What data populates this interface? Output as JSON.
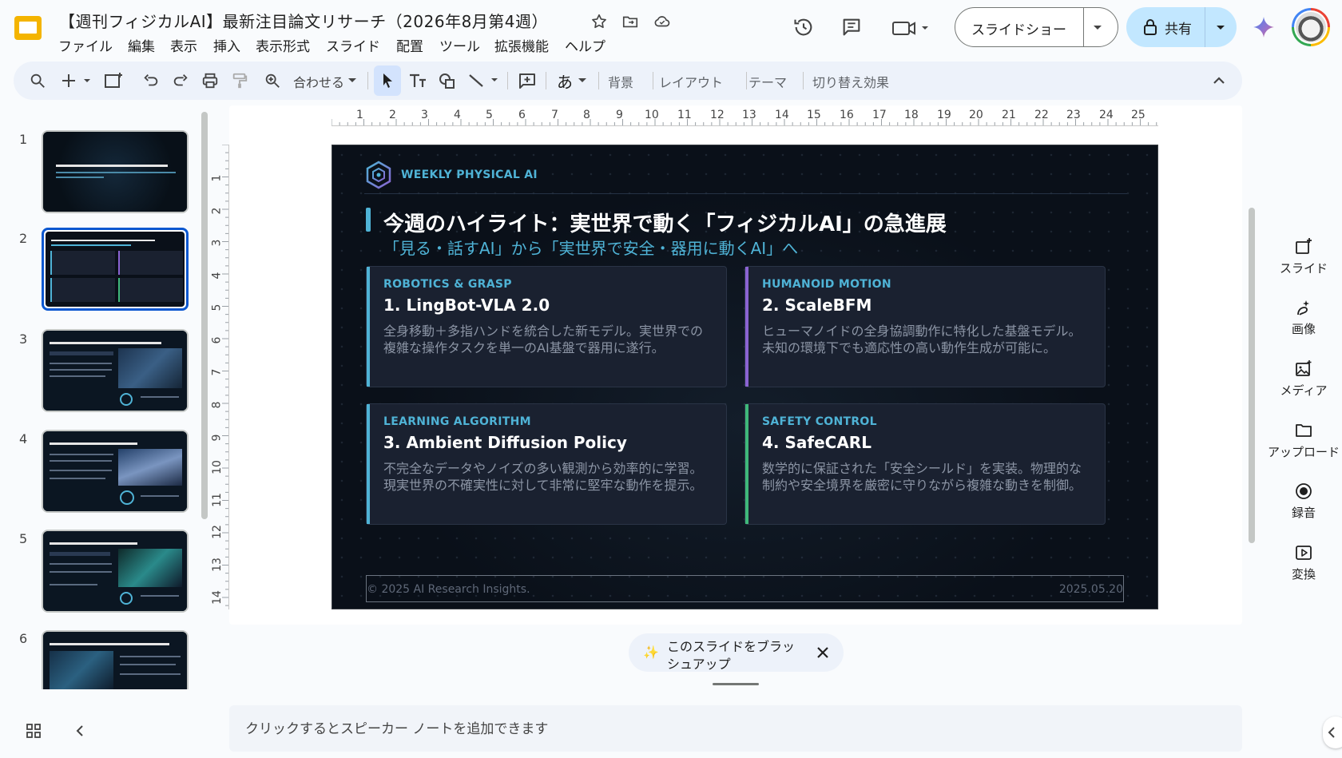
{
  "header": {
    "title": "【週刊フィジカルAI】最新注目論文リサーチ（2026年8月第4週）",
    "menu": [
      "ファイル",
      "編集",
      "表示",
      "挿入",
      "表示形式",
      "スライド",
      "配置",
      "ツール",
      "拡張機能",
      "ヘルプ"
    ],
    "slideshow_label": "スライドショー",
    "share_label": "共有"
  },
  "toolbar": {
    "zoom_label": "合わせる",
    "background": "背景",
    "layout": "レイアウト",
    "theme": "テーマ",
    "transition": "切り替え効果"
  },
  "ruler": {
    "h": [
      "1",
      "2",
      "3",
      "4",
      "5",
      "6",
      "7",
      "8",
      "9",
      "10",
      "11",
      "12",
      "13",
      "14",
      "15",
      "16",
      "17",
      "18",
      "19",
      "20",
      "21",
      "22",
      "23",
      "24",
      "25"
    ],
    "v": [
      "1",
      "2",
      "3",
      "4",
      "5",
      "6",
      "7",
      "8",
      "9",
      "10",
      "11",
      "12",
      "13",
      "14"
    ]
  },
  "slides_panel": {
    "numbers": [
      "1",
      "2",
      "3",
      "4",
      "5",
      "6"
    ],
    "selected": 2,
    "thumbs": [
      {
        "title": "【週刊フィジカルAI】最新注目論文リサーチ"
      },
      {
        "title": "今週のハイライト：実世界で動く「フィジカルAI」の急進展"
      },
      {
        "title": "LingBot-VLA 2.0: 全身移動と多指ハンドの基盤モデル"
      },
      {
        "title": "【ヒューマノイド】行動基盤モデル ScaleBFM"
      },
      {
        "title": "【模倣学習】不完全なデータから強く学ぶ"
      },
      {
        "title": "【安全制御】絶対に事故を起こさない「証明可能安全」な自律学習"
      }
    ]
  },
  "slide": {
    "brand": "WEEKLY PHYSICAL AI",
    "title": "今週のハイライト：実世界で動く「フィジカルAI」の急進展",
    "subtitle": "「見る・話すAI」から「実世界で安全・器用に動くAI」へ",
    "cards": [
      {
        "category": "ROBOTICS & GRASP",
        "title": "1. LingBot-VLA 2.0",
        "desc": "全身移動＋多指ハンドを統合した新モデル。実世界での複雑な操作タスクを単一のAI基盤で器用に遂行。",
        "accent": "#4fb3d6"
      },
      {
        "category": "HUMANOID MOTION",
        "title": "2. ScaleBFM",
        "desc": "ヒューマノイドの全身協調動作に特化した基盤モデル。未知の環境下でも適応性の高い動作生成が可能に。",
        "accent": "#8a63d2"
      },
      {
        "category": "LEARNING ALGORITHM",
        "title": "3. Ambient Diffusion Policy",
        "desc": "不完全なデータやノイズの多い観測から効率的に学習。現実世界の不確実性に対して非常に堅牢な動作を提示。",
        "accent": "#4fb3d6"
      },
      {
        "category": "SAFETY CONTROL",
        "title": "4. SafeCARL",
        "desc": "数学的に保証された「安全シールド」を実装。物理的な制約や安全境界を厳密に守りながら複雑な動きを制御。",
        "accent": "#3fb87a"
      }
    ],
    "footer_left": "© 2025 AI Research Insights.",
    "footer_right": "2025.05.20"
  },
  "side_panel": {
    "items": [
      {
        "label": "スライド",
        "icon": "add-slide-icon"
      },
      {
        "label": "画像",
        "icon": "image-sparkle-icon"
      },
      {
        "label": "メディア",
        "icon": "media-icon"
      },
      {
        "label": "アップロード",
        "icon": "folder-icon"
      },
      {
        "label": "録音",
        "icon": "record-icon"
      },
      {
        "label": "変換",
        "icon": "convert-icon"
      }
    ]
  },
  "brushup": {
    "label": "このスライドをブラッシュアップ",
    "line1": "このスライドをブラッ",
    "line2": "シュアップ"
  },
  "notes": {
    "placeholder": "クリックするとスピーカー ノートを追加できます"
  },
  "colors": {
    "accent_blue": "#0b57d0",
    "share_bg": "#c2e7ff",
    "slide_bg": "#0a1019"
  }
}
